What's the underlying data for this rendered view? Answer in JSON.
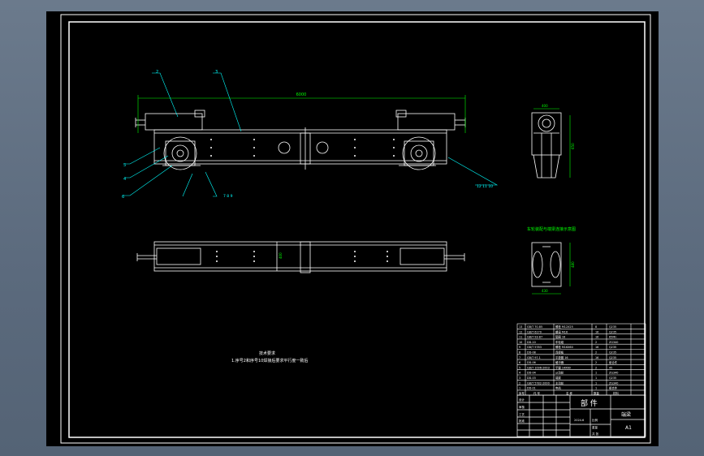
{
  "drawing": {
    "title_zh": "部 件",
    "name": "端梁",
    "sheet_size": "A1",
    "note_heading": "技术要求",
    "note_line_1": "1.序号2和序号10焊接后要求平行度一致后",
    "section_label": "车轮装配与端梁连接示意图",
    "dim_total_length": "6000",
    "dim_side_height": "650",
    "dim_side_width": "400",
    "dim_plan_width": "400",
    "dim_detail_height": "480",
    "dim_detail_width": "430",
    "label_leader_1": "2",
    "label_leader_2": "3",
    "label_leader_3": "12 11 10",
    "label_leader_4": "7 8 9",
    "label_left_5": "5",
    "label_left_4": "4",
    "label_left_6": "6"
  },
  "bom": {
    "rows": [
      {
        "no": "13",
        "code": "GB/T 70-85",
        "name": "螺栓 M12X25",
        "qty": "8",
        "mat": "Q235"
      },
      {
        "no": "12",
        "code": "GB/T 6170",
        "name": "螺母 M16",
        "qty": "16",
        "mat": "Q235"
      },
      {
        "no": "11",
        "code": "GB/T 93-87",
        "name": "垫圈 16",
        "qty": "16",
        "mat": "65Mn"
      },
      {
        "no": "10",
        "code": "DD-10",
        "name": "车轮组",
        "qty": "2",
        "mat": "ZG340"
      },
      {
        "no": "9",
        "code": "GB/T 5783",
        "name": "螺栓 M16X60",
        "qty": "16",
        "mat": "Q235"
      },
      {
        "no": "8",
        "code": "DD-08",
        "name": "连接板",
        "qty": "2",
        "mat": "Q235"
      },
      {
        "no": "7",
        "code": "GB/T 97.1",
        "name": "平垫圈 16",
        "qty": "16",
        "mat": "Q235"
      },
      {
        "no": "6",
        "code": "DD-06",
        "name": "缓冲器",
        "qty": "2",
        "mat": "组合件"
      },
      {
        "no": "5",
        "code": "GB/T 1096-2003",
        "name": "平键 14X60",
        "qty": "2",
        "mat": "45"
      },
      {
        "no": "4",
        "code": "DD-04",
        "name": "从动轮",
        "qty": "1",
        "mat": "ZG340"
      },
      {
        "no": "3",
        "code": "DD-03",
        "name": "端梁",
        "qty": "1",
        "mat": "Q235"
      },
      {
        "no": "2",
        "code": "GB/T 5782-2000",
        "name": "主动轮",
        "qty": "1",
        "mat": "ZG340"
      },
      {
        "no": "1",
        "code": "DD-01",
        "name": "电机",
        "qty": "1",
        "mat": "组合件"
      }
    ],
    "headers": {
      "no": "序号",
      "code": "代 号",
      "name": "名 称",
      "qty": "数量",
      "mat": "材料"
    }
  },
  "titleblock": {
    "designer_label": "设计",
    "check_label": "审核",
    "process_label": "工艺",
    "approve_label": "批准",
    "scale_label": "比例",
    "weight_label": "重量",
    "sheet_label": "共 张",
    "date": "2024.6"
  },
  "colors": {
    "viewport_bg": "#000000",
    "line": "#ffffff",
    "dimension": "#00ff00",
    "leader": "#00ffff",
    "frame": "#ffffff"
  }
}
